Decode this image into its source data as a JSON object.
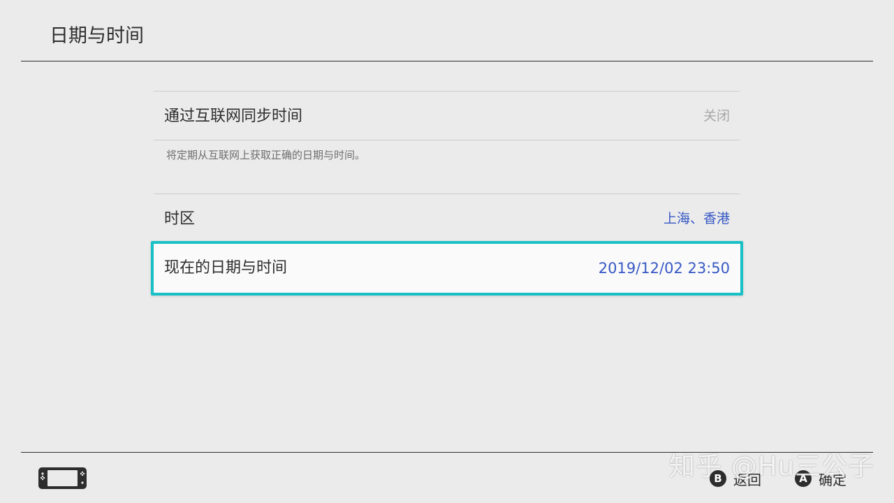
{
  "header": {
    "title": "日期与时间"
  },
  "settings": {
    "sync": {
      "label": "通过互联网同步时间",
      "value": "关闭",
      "description": "将定期从互联网上获取正确的日期与时间。"
    },
    "timezone": {
      "label": "时区",
      "value": "上海、香港"
    },
    "current_datetime": {
      "label": "现在的日期与时间",
      "value": "2019/12/02 23:50",
      "selected": true
    }
  },
  "footer": {
    "console_icon": "handheld-console-icon",
    "watermark": "知乎 @Hu三公子",
    "back": {
      "glyph": "B",
      "label": "返回"
    },
    "confirm": {
      "glyph": "A",
      "label": "确定"
    }
  },
  "colors": {
    "background": "#ebebeb",
    "selection_border": "#19c0c6",
    "value_accent": "#3758c5",
    "value_disabled": "#a8a8a8"
  }
}
